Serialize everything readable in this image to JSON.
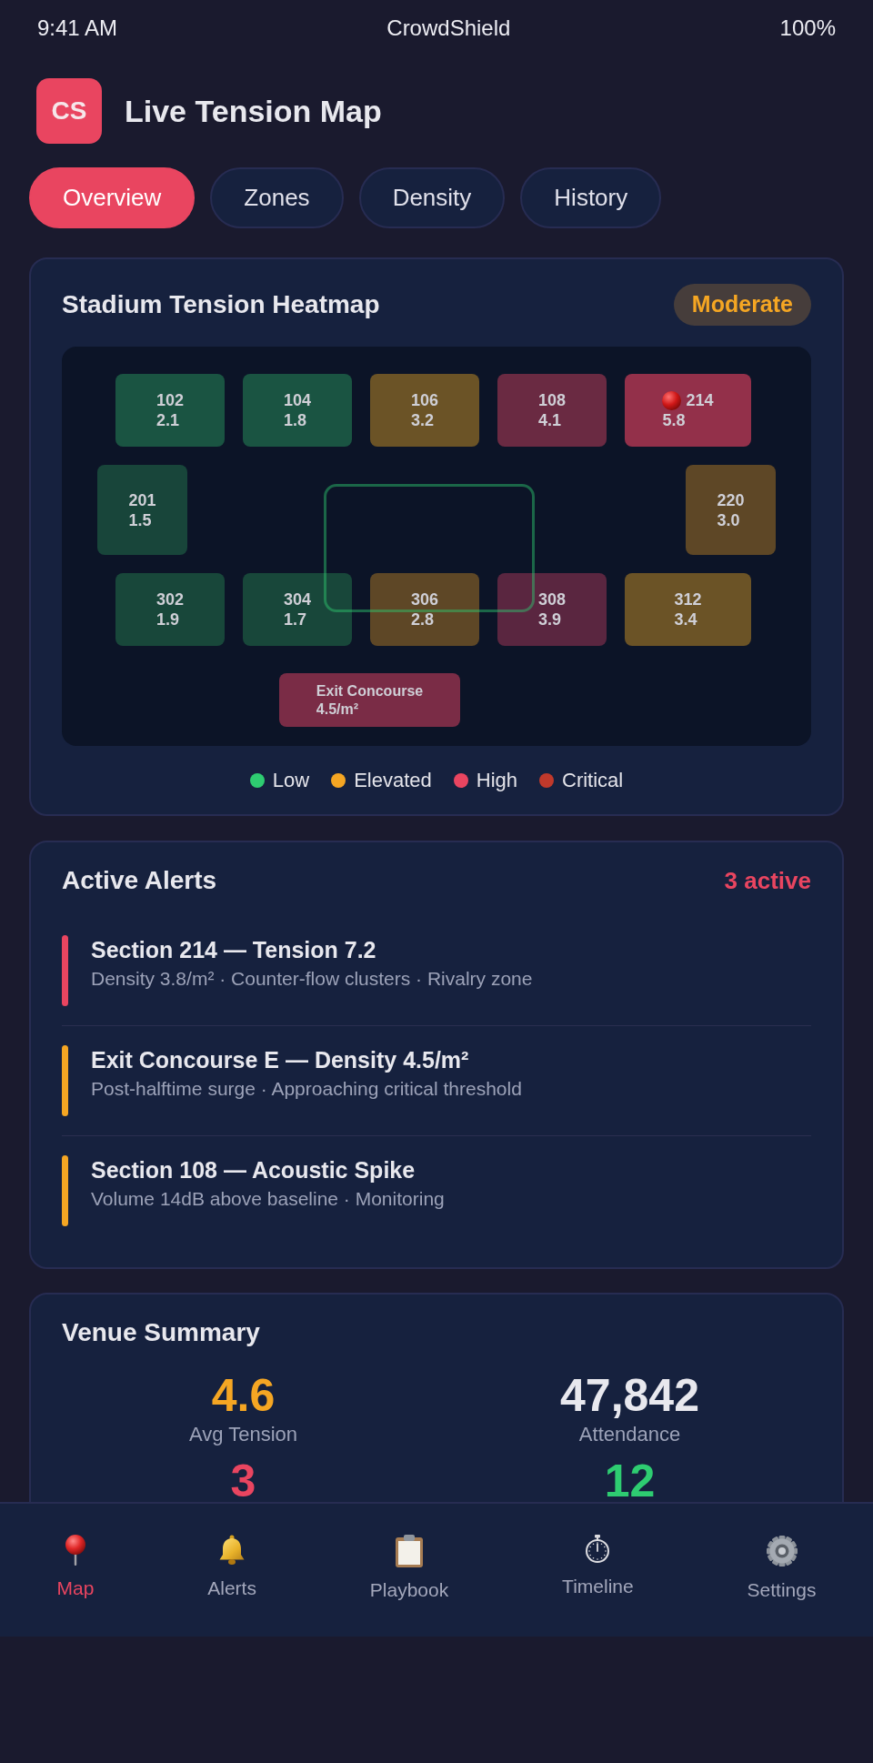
{
  "status_bar": {
    "time": "9:41 AM",
    "title": "CrowdShield",
    "battery": "100%"
  },
  "header": {
    "logo": "CS",
    "title": "Live Tension Map"
  },
  "tabs": [
    {
      "label": "Overview",
      "selected": true
    },
    {
      "label": "Zones",
      "selected": false
    },
    {
      "label": "Density",
      "selected": false
    },
    {
      "label": "History",
      "selected": false
    }
  ],
  "heatmap": {
    "title": "Stadium Tension Heatmap",
    "badge": "Moderate",
    "rows": [
      {
        "kind": "tier",
        "sections": [
          {
            "name": "102",
            "value": "2.1",
            "color": "#1a5442",
            "flagged": false
          },
          {
            "name": "104",
            "value": "1.8",
            "color": "#1a5442",
            "flagged": false
          },
          {
            "name": "106",
            "value": "3.2",
            "color": "#6b5326",
            "flagged": false
          },
          {
            "name": "108",
            "value": "4.1",
            "color": "#6a2a42",
            "flagged": false
          },
          {
            "name": "214",
            "value": "5.8",
            "color": "#93304a",
            "flagged": true
          }
        ]
      },
      {
        "kind": "sides",
        "sections": [
          {
            "name": "201",
            "value": "1.5",
            "color": "#18453a",
            "flagged": false
          },
          {
            "name": "220",
            "value": "3.0",
            "color": "#5e4726",
            "flagged": false
          }
        ]
      },
      {
        "kind": "tier",
        "sections": [
          {
            "name": "302",
            "value": "1.9",
            "color": "#18473a",
            "flagged": false
          },
          {
            "name": "304",
            "value": "1.7",
            "color": "#18473a",
            "flagged": false
          },
          {
            "name": "306",
            "value": "2.8",
            "color": "#5e4726",
            "flagged": false
          },
          {
            "name": "308",
            "value": "3.9",
            "color": "#5a2640",
            "flagged": false
          },
          {
            "name": "312",
            "value": "3.4",
            "color": "#6b5326",
            "flagged": false
          }
        ]
      },
      {
        "kind": "exit",
        "sections": [
          {
            "name": "Exit Concourse",
            "value": "4.5/m²",
            "color": "#7a2c46",
            "flagged": false
          }
        ]
      }
    ],
    "legend": [
      {
        "label": "Low",
        "color": "#2ecc71"
      },
      {
        "label": "Elevated",
        "color": "#f5a623"
      },
      {
        "label": "High",
        "color": "#e94560"
      },
      {
        "label": "Critical",
        "color": "#c0392b"
      }
    ]
  },
  "alerts": {
    "title": "Active Alerts",
    "count": "3 active",
    "items": [
      {
        "title": "Section 214 — Tension 7.2",
        "detail": "Density 3.8/m² · Counter-flow clusters · Rivalry zone",
        "color": "#e94560"
      },
      {
        "title": "Exit Concourse E — Density 4.5/m²",
        "detail": "Post-halftime surge · Approaching critical threshold",
        "color": "#f5a623"
      },
      {
        "title": "Section 108 — Acoustic Spike",
        "detail": "Volume 14dB above baseline · Monitoring",
        "color": "#f5a623"
      }
    ]
  },
  "summary": {
    "title": "Venue Summary",
    "stats": [
      {
        "value": "4.6",
        "label": "Avg Tension",
        "color": "#f5a623"
      },
      {
        "value": "47,842",
        "label": "Attendance",
        "color": "#e8e8ee"
      },
      {
        "value": "3",
        "color": "#e94560"
      },
      {
        "value": "12",
        "color": "#2ecc71"
      }
    ]
  },
  "nav": [
    {
      "label": "Map",
      "kind": "pin",
      "selected": true
    },
    {
      "label": "Alerts",
      "kind": "bell",
      "selected": false
    },
    {
      "label": "Playbook",
      "kind": "clipboard",
      "selected": false
    },
    {
      "label": "Timeline",
      "kind": "stopwatch",
      "selected": false
    },
    {
      "label": "Settings",
      "kind": "gear",
      "selected": false
    }
  ]
}
